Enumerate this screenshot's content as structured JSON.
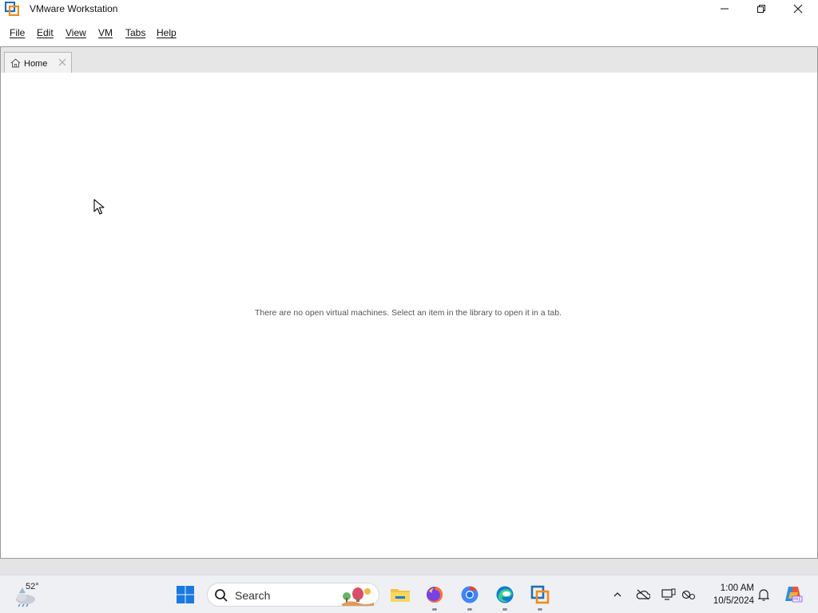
{
  "window": {
    "title": "VMware Workstation",
    "controls": {
      "minimize": "minimize",
      "maximize": "restore",
      "close": "close"
    }
  },
  "menu": {
    "items": [
      {
        "label": "File"
      },
      {
        "label": "Edit"
      },
      {
        "label": "View"
      },
      {
        "label": "VM"
      },
      {
        "label": "Tabs"
      },
      {
        "label": "Help"
      }
    ]
  },
  "tabs": [
    {
      "label": "Home",
      "icon": "home-icon",
      "active": true
    }
  ],
  "content": {
    "empty_message": "There are no open virtual machines. Select an item in the library to open it in a tab."
  },
  "taskbar": {
    "weather": {
      "temperature": "52°",
      "icon": "partly-cloudy-icon"
    },
    "search": {
      "label": "Search"
    },
    "apps": [
      {
        "name": "start",
        "icon": "windows-start-icon"
      },
      {
        "name": "file-explorer",
        "icon": "folder-icon"
      },
      {
        "name": "firefox",
        "icon": "firefox-icon"
      },
      {
        "name": "chrome",
        "icon": "chrome-icon"
      },
      {
        "name": "edge",
        "icon": "edge-icon"
      },
      {
        "name": "vmware-workstation",
        "icon": "vmware-icon"
      }
    ],
    "tray": {
      "icons": [
        "chevron-up-icon",
        "onedrive-icon",
        "device-icon",
        "network-icon",
        "notification-bell-icon",
        "copilot-icon"
      ],
      "time": "1:00 AM",
      "date": "10/5/2024"
    }
  },
  "colors": {
    "tab_strip": "#e6e6e6",
    "status_bar": "#e4e4e4",
    "taskbar": "#eef0f4",
    "vmware_orange": "#f08a1c",
    "vmware_blue": "#1f6fb5"
  }
}
